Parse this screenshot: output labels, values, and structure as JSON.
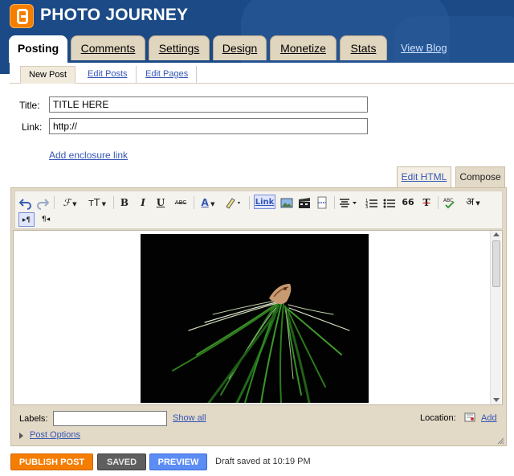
{
  "header": {
    "blog_title": "PHOTO JOURNEY",
    "brand_color": "#f57d00",
    "header_color": "#1b4a86"
  },
  "tabs": [
    {
      "label": "Posting",
      "active": true
    },
    {
      "label": "Comments",
      "active": false
    },
    {
      "label": "Settings",
      "active": false
    },
    {
      "label": "Design",
      "active": false
    },
    {
      "label": "Monetize",
      "active": false
    },
    {
      "label": "Stats",
      "active": false
    }
  ],
  "view_blog": "View Blog",
  "subtabs": [
    {
      "label": "New Post",
      "active": true
    },
    {
      "label": "Edit Posts",
      "active": false
    },
    {
      "label": "Edit Pages",
      "active": false
    }
  ],
  "form": {
    "title_label": "Title:",
    "title_value": "TITLE HERE",
    "link_label": "Link:",
    "link_value": "http://",
    "enclosure_link": "Add enclosure link"
  },
  "editor_modes": {
    "html": "Edit HTML",
    "compose": "Compose"
  },
  "toolbar": {
    "undo_icon": "undo-icon",
    "redo_icon": "redo-icon",
    "font_label": "ℱ",
    "size_label": "тT",
    "bold_label": "B",
    "italic_label": "I",
    "underline_label": "U",
    "strike_label": "ABC",
    "text_color_label": "A",
    "link_label": "Link",
    "quote_label": "66",
    "clear_format_label": "T",
    "transliterate_label": "अ",
    "ltr_label": "▸¶",
    "rtl_label": "¶◂"
  },
  "content": {
    "image_description": "photo-green-plant-on-black"
  },
  "footer": {
    "labels_label": "Labels:",
    "labels_value": "",
    "show_all": "Show all",
    "location_label": "Location:",
    "location_add": "Add",
    "post_options": "Post Options"
  },
  "actions": {
    "publish": "PUBLISH POST",
    "saved": "SAVED",
    "preview": "PREVIEW",
    "draft_status": "Draft saved at 10:19 PM"
  }
}
